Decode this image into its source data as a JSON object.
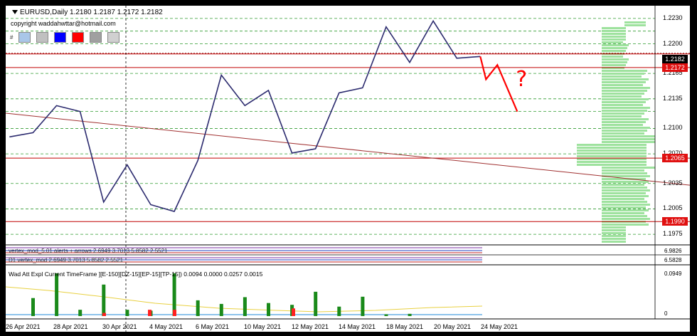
{
  "header": {
    "symbol_info": "EURUSD,Daily  1.2180 1.2187 1.2172 1.2182",
    "copyright": "copyright waddahwttar@hotmail.com",
    "toolbar_num": "#"
  },
  "toolbar": {
    "swatches": [
      {
        "name": "swatch-light-blue",
        "color": "#a9c6e8"
      },
      {
        "name": "swatch-gray",
        "color": "#c0c0c0"
      },
      {
        "name": "swatch-blue",
        "color": "#0000ff"
      },
      {
        "name": "swatch-red",
        "color": "#ff0000"
      },
      {
        "name": "swatch-silver",
        "color": "#a0a0a0"
      },
      {
        "name": "swatch-lines",
        "color": "#d0d0d0"
      }
    ]
  },
  "price_axis": {
    "ticks": [
      "1.2230",
      "1.2200",
      "1.2165",
      "1.2135",
      "1.2100",
      "1.2035",
      "1.2005",
      "1.1975"
    ],
    "current_price": "1.2182",
    "level_labels": [
      "1.2172",
      "1.2065",
      "1.1990"
    ],
    "partial_label": "1.2070"
  },
  "x_axis": {
    "labels": [
      "26 Apr 2021",
      "28 Apr 2021",
      "30 Apr 2021",
      "4 May 2021",
      "6 May 2021",
      "10 May 2021",
      "12 May 2021",
      "14 May 2021",
      "18 May 2021",
      "20 May 2021",
      "24 May 2021"
    ]
  },
  "indicators": {
    "vertex1_title": "vertex_mod_5.01 alerts + arrows 2.6949 3.7013 5.8582 2.5521",
    "vertex2_title": "D1 vertex_mod 2.6949 3.7013 5.8582 2.5521",
    "wad_title": "Wad Att Expl",
    "wad_params": "Current TimeFrame ][E-150][DZ-15][EP-15][TP-15]) 0.0094 0.0000 0.0257 0.0015",
    "wad_max": "0.0949",
    "wad_zero": "0",
    "vertex_axis_labels": [
      "6.9826",
      "6.5828"
    ]
  },
  "annotation": {
    "question_mark": "?"
  },
  "chart_data": {
    "type": "line",
    "title": "EURUSD,Daily",
    "x": [
      "26 Apr",
      "27 Apr",
      "28 Apr",
      "29 Apr",
      "30 Apr",
      "3 May",
      "4 May",
      "5 May",
      "6 May",
      "7 May",
      "10 May",
      "11 May",
      "12 May",
      "13 May",
      "14 May",
      "17 May",
      "18 May",
      "19 May",
      "20 May",
      "21 May",
      "24 May"
    ],
    "series": [
      {
        "values": [
          1.209,
          1.2095,
          1.2127,
          1.212,
          1.2013,
          1.2057,
          1.201,
          1.2002,
          1.2062,
          1.2163,
          1.2127,
          1.2145,
          1.2071,
          1.2076,
          1.2142,
          1.2148,
          1.222,
          1.2178,
          1.2227,
          1.2183,
          1.2185
        ]
      }
    ],
    "forecast": [
      1.2185,
      1.2158,
      1.2175,
      1.212
    ],
    "ylim": [
      1.1965,
      1.2245
    ],
    "levels": {
      "red": [
        1.2188,
        1.2172,
        1.2065,
        1.199
      ]
    },
    "wad_bars": {
      "green": [
        0.04,
        0.0949,
        0.014,
        0.07,
        0.014,
        0.012,
        0.0949,
        0.035,
        0.027,
        0.042,
        0.029,
        0.025,
        0.054,
        0.021,
        0.043,
        0.004,
        0.005
      ],
      "red": [
        0.007,
        0.014,
        0.014,
        0.017
      ]
    }
  }
}
